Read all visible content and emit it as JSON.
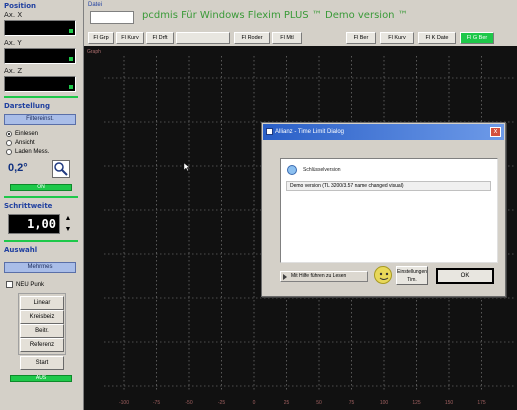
{
  "left_panel": {
    "position_title": "Position",
    "axis_x_label": "Ax. X",
    "axis_y_label": "Ax. Y",
    "axis_z_label": "Ax. Z",
    "section_1_title": "Darstellung",
    "section_1_button": "Filtereinst.",
    "radio_options": [
      "Einlesen",
      "Ansicht",
      "Laden Mess."
    ],
    "zoom_label": "0,2°",
    "green_label_1": "ON",
    "section_2_title": "Schrittweite",
    "step_value": "1,00",
    "section_3_title": "Auswahl",
    "section_3_button": "Mehrmes",
    "checkbox_label": "NEU Punk",
    "buttons": [
      "Linear",
      "Kreisbeiz",
      "Beitr.",
      "Referenz"
    ],
    "start_button": "Start",
    "green_label_2": "AUS"
  },
  "top_bar": {
    "menu_label": "Datei",
    "title": "pcdmis Für Windows Flexim PLUS ™ Demo version ™",
    "buttons": [
      "Fl Grp",
      "Fl Kurv",
      "Fl Drft",
      "",
      "Fl Roder",
      "Fl Mtl",
      "Fl Ber",
      "Fl Kurv",
      "Fl K Date",
      "Fl G Ber"
    ],
    "plot_corner_label": "Graph"
  },
  "plot": {
    "x_tick_labels": [
      "-100",
      "-75",
      "-50",
      "-25",
      "0",
      "25",
      "50",
      "75",
      "100",
      "125",
      "150",
      "175"
    ]
  },
  "dialog": {
    "title": "Allianz - Time Limit Dialog",
    "close_label": "x",
    "heading": "Schlüsselversion",
    "message": "Demo version (TL 3200/3.57 name changed visual)",
    "tip_label": "Mit Hilfe führen zu Lesen",
    "help_button": "Einstellungen Tim.",
    "ok_button": "OK"
  },
  "colors": {
    "plot_bg": "#111111",
    "grid_line": "#8a8a8a",
    "accent_green": "#1ec84a",
    "accent_blue": "#a9bde8",
    "dialog_titlebar": "#2a5fc7"
  }
}
